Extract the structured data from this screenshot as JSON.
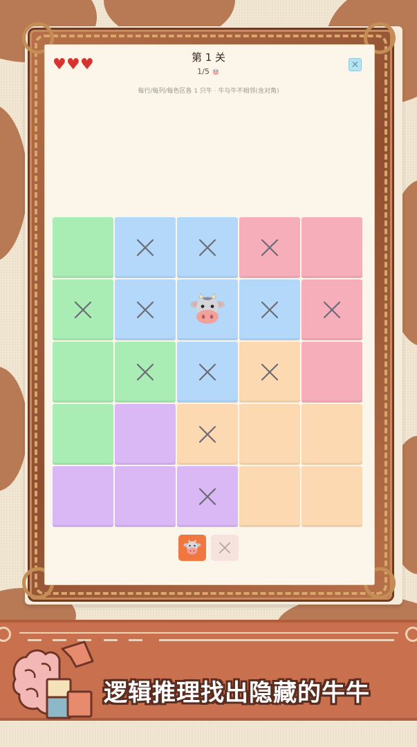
{
  "header": {
    "hearts": [
      "♥",
      "♥",
      "♥"
    ],
    "level_title": "第 1 关",
    "progress_text": "1/5",
    "rules_text": "每行/每列/每色区各 1 只牛 · 牛与牛不相邻(含对角)",
    "close_symbol": "✕"
  },
  "board": {
    "rows": 5,
    "cols": 5,
    "cells": [
      [
        "green",
        "blue:x",
        "blue:x",
        "pink:x",
        "pink"
      ],
      [
        "green:x",
        "blue:x",
        "blue:cow",
        "blue:x",
        "pink:x"
      ],
      [
        "green",
        "green:x",
        "blue:x",
        "orange:x",
        "pink"
      ],
      [
        "green",
        "purple",
        "orange:x",
        "orange",
        "orange"
      ],
      [
        "purple",
        "purple",
        "purple:x",
        "orange",
        "orange"
      ]
    ]
  },
  "toolbar": {
    "cow_tool": "cow",
    "x_tool": "✕"
  },
  "banner": {
    "slogan": "逻辑推理找出隐藏的牛牛"
  },
  "colors": {
    "green": "#a9ecb4",
    "blue": "#b3d8fa",
    "pink": "#f7aebb",
    "orange": "#fdd9b2",
    "purple": "#dab7f5",
    "heart": "#d8342f",
    "accent": "#f0773f"
  }
}
